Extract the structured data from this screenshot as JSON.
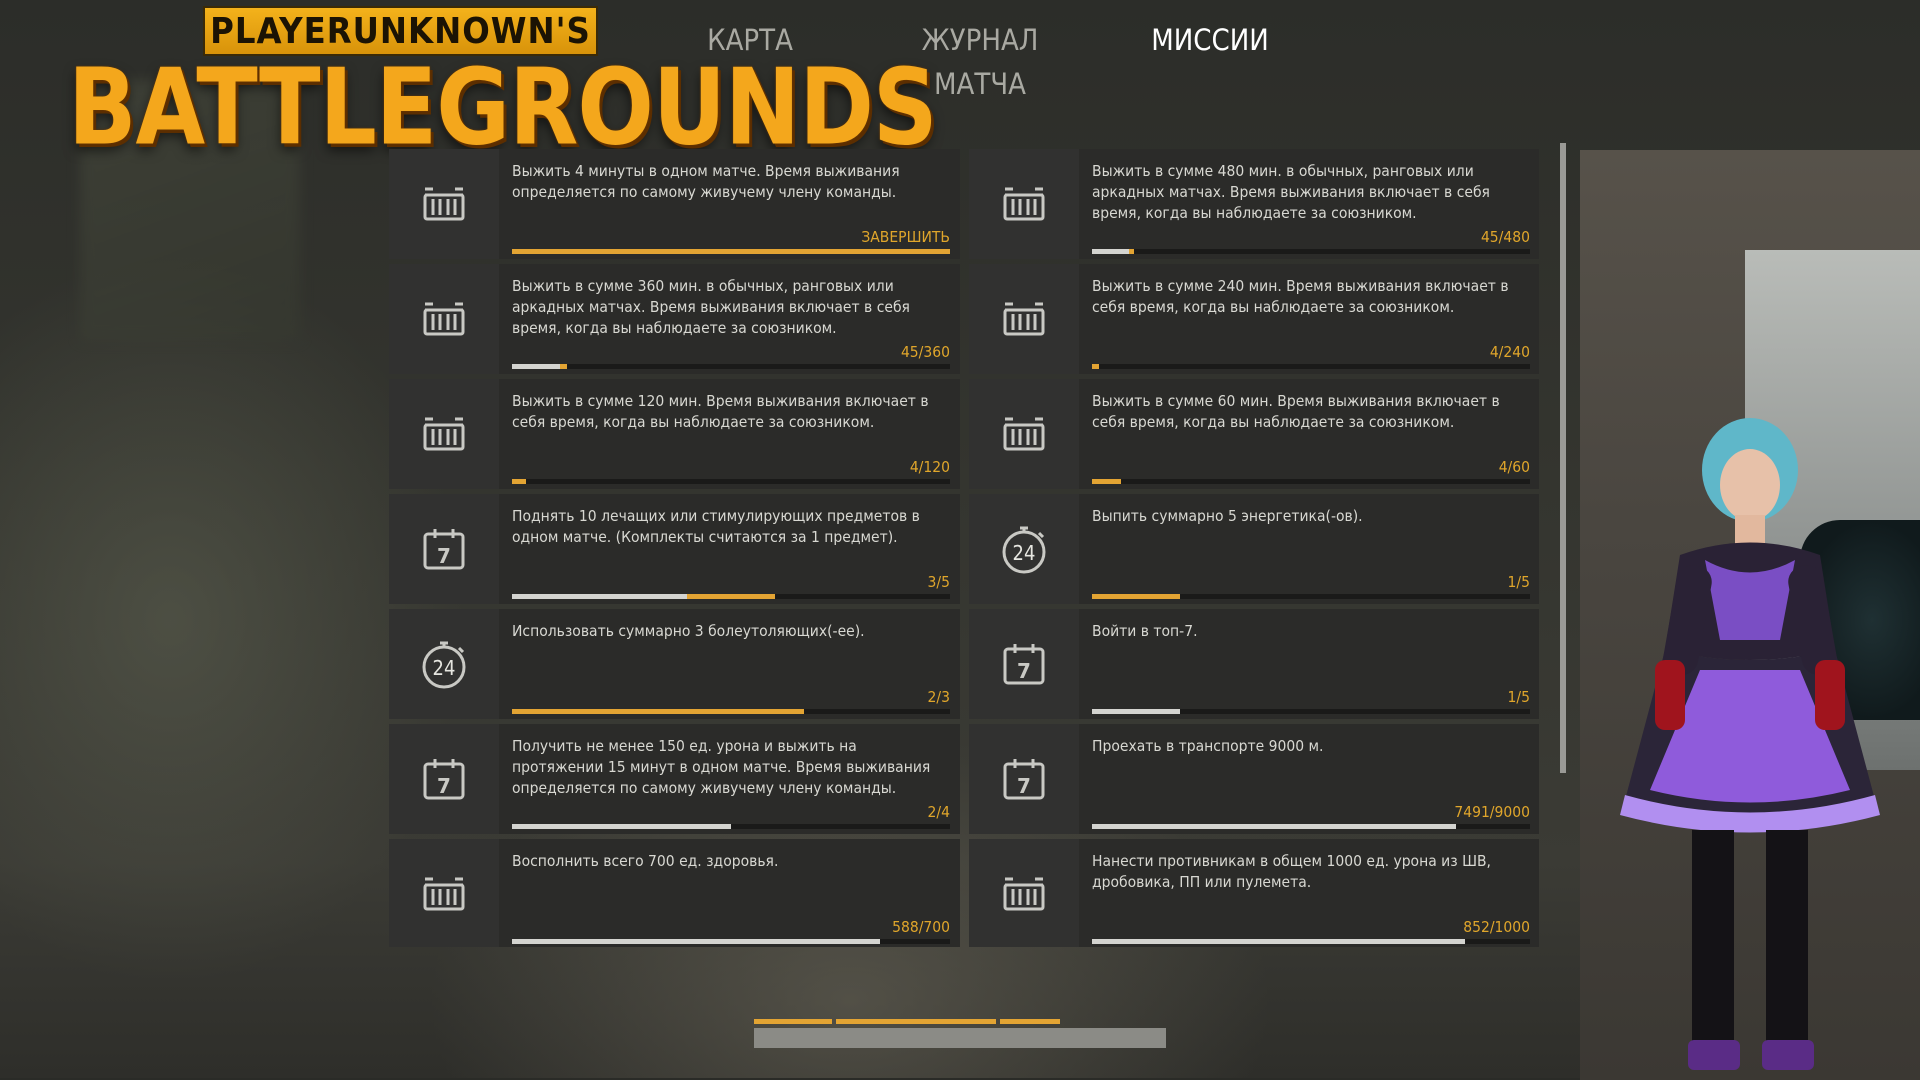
{
  "logo": {
    "line1": "PLAYERUNKNOWN'S",
    "line2": "BATTLEGROUNDS"
  },
  "nav": {
    "tabs": [
      {
        "label": "КАРТА",
        "active": false
      },
      {
        "label": "ЖУРНАЛ МАТЧА",
        "active": false
      },
      {
        "label": "МИССИИ",
        "active": true
      }
    ]
  },
  "missions": [
    {
      "icon": "crate-icon",
      "text": "Выжить 4 минуты в одном матче. Время выживания определяется по самому живучему члену команды.",
      "progress_label": "ЗАВЕРШИТЬ",
      "completed": 1.0,
      "new_progress": 0.0
    },
    {
      "icon": "crate-icon",
      "text": "Выжить в сумме 480 мин. в обычных, ранговых или аркадных матчах. Время выживания включает в себя время, когда вы наблюдаете за союзником.",
      "progress_label": "45/480",
      "completed": 0.085,
      "new_progress": 0.012
    },
    {
      "icon": "crate-icon",
      "text": "Выжить в сумме 360 мин. в обычных, ранговых или аркадных матчах. Время выживания включает в себя время, когда вы наблюдаете за союзником.",
      "progress_label": "45/360",
      "completed": 0.11,
      "new_progress": 0.015
    },
    {
      "icon": "crate-icon",
      "text": "Выжить в сумме 240 мин. Время выживания включает в себя время, когда вы наблюдаете за союзником.",
      "progress_label": "4/240",
      "completed": 0.0,
      "new_progress": 0.017
    },
    {
      "icon": "crate-icon",
      "text": "Выжить в сумме 120 мин. Время выживания включает в себя время, когда вы наблюдаете за союзником.",
      "progress_label": "4/120",
      "completed": 0.0,
      "new_progress": 0.033
    },
    {
      "icon": "crate-icon",
      "text": "Выжить в сумме 60 мин. Время выживания включает в себя время, когда вы наблюдаете за союзником.",
      "progress_label": "4/60",
      "completed": 0.0,
      "new_progress": 0.067
    },
    {
      "icon": "calendar-7-icon",
      "text": "Поднять 10 лечащих или стимулирующих предметов в одном матче. (Комплекты считаются за 1 предмет).",
      "progress_label": "3/5",
      "completed": 0.4,
      "new_progress": 0.2
    },
    {
      "icon": "stopwatch-24-icon",
      "text": "Выпить суммарно 5 энергетика(-ов).",
      "progress_label": "1/5",
      "completed": 0.0,
      "new_progress": 0.2
    },
    {
      "icon": "stopwatch-24-icon",
      "text": "Использовать суммарно 3 болеутоляющих(-ее).",
      "progress_label": "2/3",
      "completed": 0.0,
      "new_progress": 0.667
    },
    {
      "icon": "calendar-7-icon",
      "text": "Войти в топ-7.",
      "progress_label": "1/5",
      "completed": 0.2,
      "new_progress": 0.0
    },
    {
      "icon": "calendar-7-icon",
      "text": "Получить не менее 150 ед. урона и выжить на протяжении 15 минут в одном матче. Время выживания определяется по самому живучему члену команды.",
      "progress_label": "2/4",
      "completed": 0.5,
      "new_progress": 0.0
    },
    {
      "icon": "calendar-7-icon",
      "text": "Проехать в транспорте 9000 м.",
      "progress_label": "7491/9000",
      "completed": 0.832,
      "new_progress": 0.0
    },
    {
      "icon": "crate-icon",
      "text": "Восполнить всего 700 ед. здоровья.",
      "progress_label": "588/700",
      "completed": 0.84,
      "new_progress": 0.0
    },
    {
      "icon": "crate-icon",
      "text": "Нанести противникам в общем 1000 ед. урона из ШВ, дробовика, ПП или пулемета.",
      "progress_label": "852/1000",
      "completed": 0.852,
      "new_progress": 0.0
    }
  ],
  "colors": {
    "accent": "#e3a433",
    "progress_text": "#e0a62b",
    "text": "#d8d8d2",
    "card_bg": "#2b2b29"
  }
}
